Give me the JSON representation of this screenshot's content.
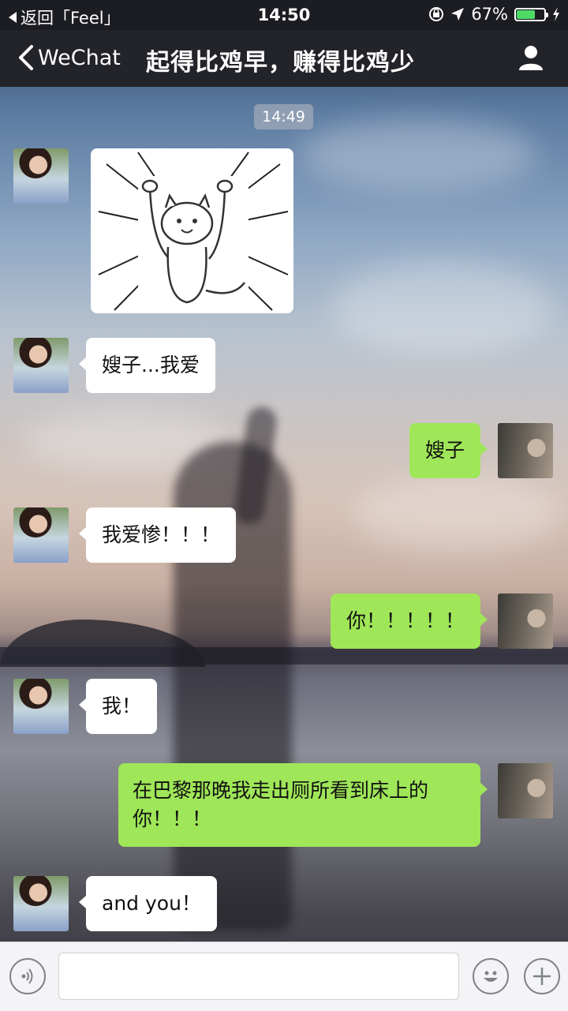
{
  "status_bar": {
    "back_app": "返回「Feel」",
    "time": "14:50",
    "battery_percent": "67%",
    "battery_level": 0.67,
    "icons": [
      "back-triangle-icon",
      "rotation-lock-icon",
      "location-arrow-icon",
      "battery-icon",
      "charging-bolt-icon"
    ]
  },
  "nav": {
    "back_label": "WeChat",
    "title": "起得比鸡早，赚得比鸡少",
    "profile_icon": "person-icon"
  },
  "chat": {
    "timestamp": "14:49",
    "messages": [
      {
        "side": "left",
        "type": "sticker",
        "text": ""
      },
      {
        "side": "left",
        "type": "text",
        "text": "嫂子...我爱"
      },
      {
        "side": "right",
        "type": "text",
        "text": "嫂子"
      },
      {
        "side": "left",
        "type": "text",
        "text": "我爱惨！！！"
      },
      {
        "side": "right",
        "type": "text",
        "text": "你！！！！！"
      },
      {
        "side": "left",
        "type": "text",
        "text": "我！"
      },
      {
        "side": "right",
        "type": "text",
        "text": "在巴黎那晚我走出厕所看到床上的你！！！"
      },
      {
        "side": "left",
        "type": "text",
        "text": "and you！"
      }
    ]
  },
  "input_bar": {
    "voice_icon": "voice-icon",
    "input_value": "",
    "emoji_icon": "emoji-icon",
    "plus_icon": "plus-icon"
  },
  "colors": {
    "bar_dark": "#23242a",
    "bubble_self": "#9fe658",
    "bubble_other": "#ffffff",
    "battery_green": "#4cd964"
  }
}
